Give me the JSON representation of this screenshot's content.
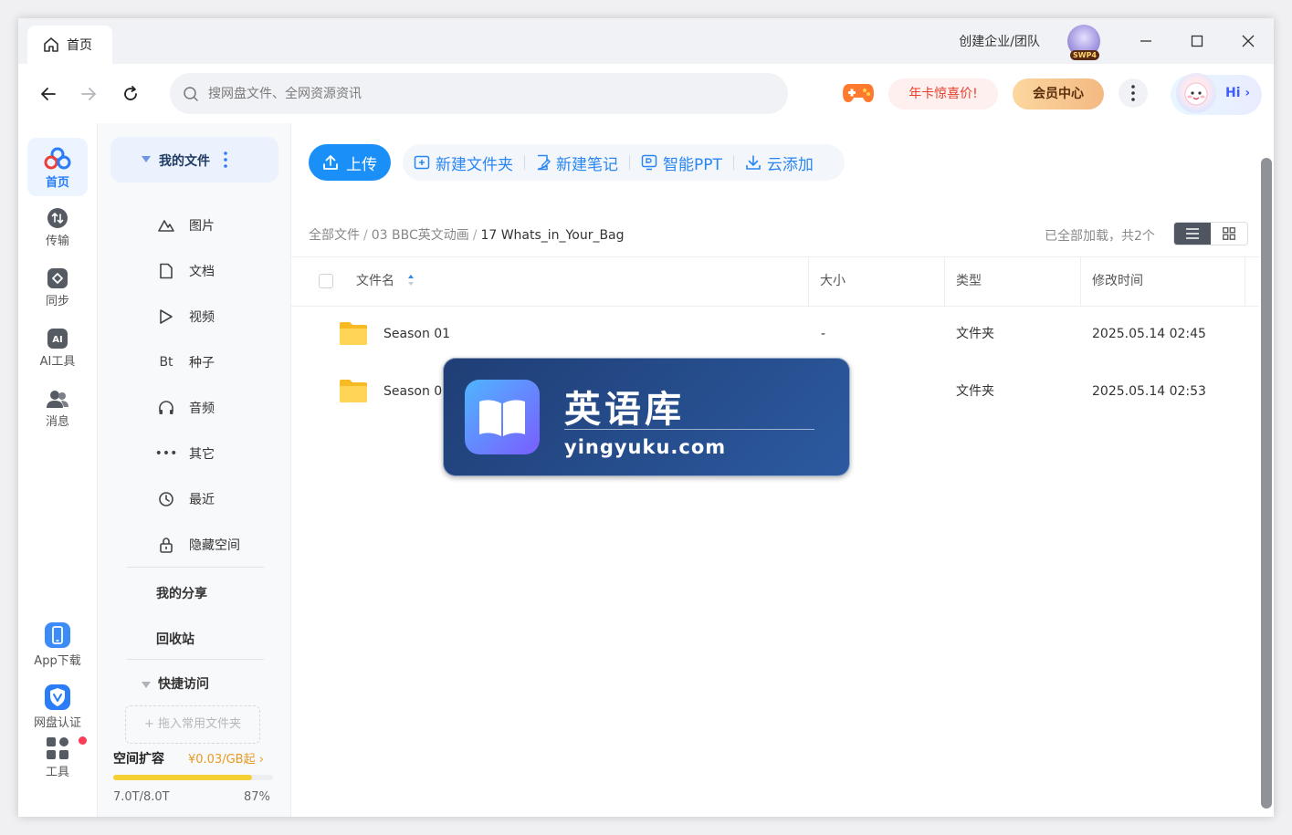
{
  "titlebar": {
    "tab_label": "首页",
    "org_link": "创建企业/团队",
    "avatar_badge": "SWP4"
  },
  "toolbar": {
    "search_placeholder": "搜网盘文件、全网资源资讯",
    "deal_label": "年卡惊喜价!",
    "vip_label": "会员中心",
    "hi_label": "Hi ›"
  },
  "rail": {
    "items": [
      {
        "label": "首页",
        "icon": "cloud-logo-icon"
      },
      {
        "label": "传输",
        "icon": "transfer-icon"
      },
      {
        "label": "同步",
        "icon": "sync-icon"
      },
      {
        "label": "AI工具",
        "icon": "ai-icon"
      },
      {
        "label": "消息",
        "icon": "message-icon"
      }
    ],
    "bottom": [
      {
        "label": "App下载",
        "icon": "phone-icon"
      },
      {
        "label": "网盘认证",
        "icon": "verify-shield-icon"
      },
      {
        "label": "工具",
        "icon": "tools-grid-icon"
      }
    ]
  },
  "side": {
    "my_files": "我的文件",
    "items": [
      {
        "label": "图片",
        "icon": "picture-icon"
      },
      {
        "label": "文档",
        "icon": "document-icon"
      },
      {
        "label": "视频",
        "icon": "video-play-icon"
      },
      {
        "label": "种子",
        "icon_text": "Bt"
      },
      {
        "label": "音频",
        "icon": "headphones-icon"
      },
      {
        "label": "其它",
        "icon_text": "•••"
      },
      {
        "label": "最近",
        "icon": "clock-icon"
      },
      {
        "label": "隐藏空间",
        "icon": "lock-icon"
      }
    ],
    "my_share": "我的分享",
    "recycle": "回收站",
    "quick_access": "快捷访问",
    "drop_hint": "+ 拖入常用文件夹",
    "capacity": {
      "label": "空间扩容",
      "price": "¥0.03/GB起 ›",
      "used": "7.0T/8.0T",
      "percent_label": "87%",
      "fraction": 0.87
    }
  },
  "main": {
    "upload": "上传",
    "actions": [
      "新建文件夹",
      "新建笔记",
      "智能PPT",
      "云添加"
    ],
    "breadcrumb": {
      "root": "全部文件",
      "mid": "03 BBC英文动画",
      "current": "17 Whats_in_Your_Bag"
    },
    "loaded_text": "已全部加载，共2个",
    "columns": [
      "文件名",
      "大小",
      "类型",
      "修改时间"
    ],
    "rows": [
      {
        "name": "Season 01",
        "size": "-",
        "type": "文件夹",
        "modified": "2025.05.14 02:45"
      },
      {
        "name": "Season 0",
        "size": "",
        "type": "文件夹",
        "modified": "2025.05.14 02:53"
      }
    ]
  },
  "watermark": {
    "title": "英语库",
    "url": "yingyuku.com"
  },
  "colors": {
    "accent": "#1a8ff7",
    "vip_gold": "#f4b983",
    "deal_red": "#e8402c",
    "capacity_yellow": "#f5cf33"
  }
}
